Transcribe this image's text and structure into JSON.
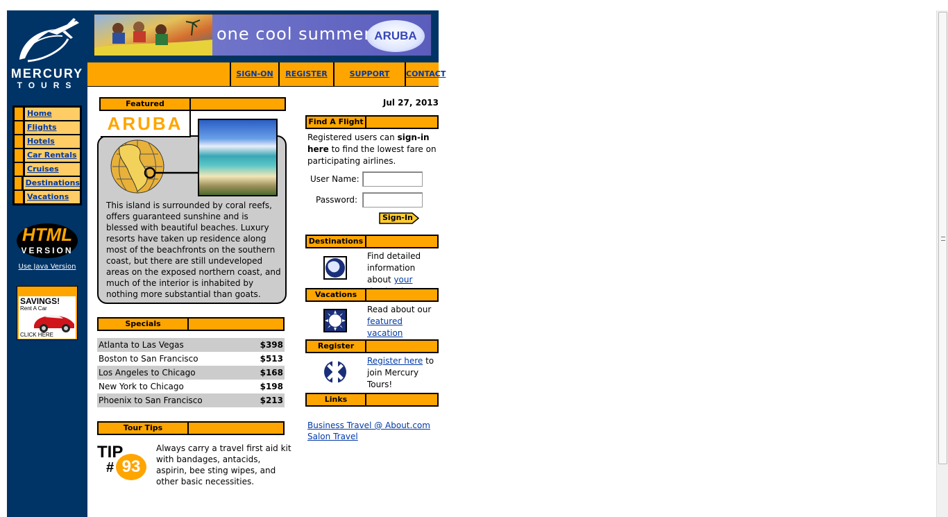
{
  "brand": {
    "name": "MERCURY",
    "sub": "TOURS"
  },
  "banner": {
    "text": "one cool summer",
    "logo": "ARUBA"
  },
  "nav": [
    {
      "label": "SIGN-ON"
    },
    {
      "label": "REGISTER"
    },
    {
      "label": "SUPPORT"
    },
    {
      "label": "CONTACT"
    }
  ],
  "sidebar": {
    "items": [
      {
        "label": "Home"
      },
      {
        "label": "Flights"
      },
      {
        "label": "Hotels"
      },
      {
        "label": "Car Rentals"
      },
      {
        "label": "Cruises"
      },
      {
        "label": "Destinations"
      },
      {
        "label": "Vacations"
      }
    ],
    "html_version_line1": "HTML",
    "html_version_line2": "VERSION",
    "java_link": "Use Java Version",
    "ad": {
      "title": "SAVINGS!",
      "sub": "Rent A Car",
      "cta": "CLICK HERE"
    }
  },
  "featured": {
    "title": "Featured Destination",
    "name": "ARUBA",
    "description": "This island is surrounded by coral reefs, offers guaranteed sunshine and is blessed with beautiful beaches. Luxury resorts have taken up residence along most of the beachfronts on the southern coast, but there are still undeveloped areas on the exposed northern coast, and much of the interior is inhabited by nothing more substantial than goats."
  },
  "specials": {
    "title": "Specials",
    "rows": [
      {
        "route": "Atlanta to Las Vegas",
        "price": "$398"
      },
      {
        "route": "Boston to San Francisco",
        "price": "$513"
      },
      {
        "route": "Los Angeles to Chicago",
        "price": "$168"
      },
      {
        "route": "New York to Chicago",
        "price": "$198"
      },
      {
        "route": "Phoenix to San Francisco",
        "price": "$213"
      }
    ]
  },
  "tips": {
    "title": "Tour Tips",
    "badge_word": "TIP",
    "badge_hash": "#",
    "badge_num": "93",
    "text": "Always carry a travel first aid kit with bandages, antacids, aspirin, bee sting wipes, and other basic necessities."
  },
  "date": "Jul 27, 2013",
  "find_flight": {
    "title": "Find A Flight",
    "text_a": "Registered users can ",
    "text_b": "sign-in here",
    "text_c": " to find the lowest fare on participating airlines.",
    "username_label": "User Name:",
    "password_label": "Password:",
    "signin_label": "Sign-In"
  },
  "destinations": {
    "title": "Destinations",
    "text_a": "Find detailed information about ",
    "link": "your destination",
    "text_b": "."
  },
  "vacations": {
    "title": "Vacations",
    "text_a": "Read about our ",
    "link": "featured vacation destinations",
    "text_b": "."
  },
  "register": {
    "title": "Register",
    "link": "Register here",
    "text_b": " to join Mercury Tours!"
  },
  "links": {
    "title": "Links",
    "items": [
      {
        "label": "Business Travel @ About.com"
      },
      {
        "label": "Salon Travel"
      }
    ]
  },
  "colors": {
    "navy": "#003366",
    "orange": "#ffa500",
    "light_orange": "#ffcc66",
    "link": "#0039a6"
  }
}
